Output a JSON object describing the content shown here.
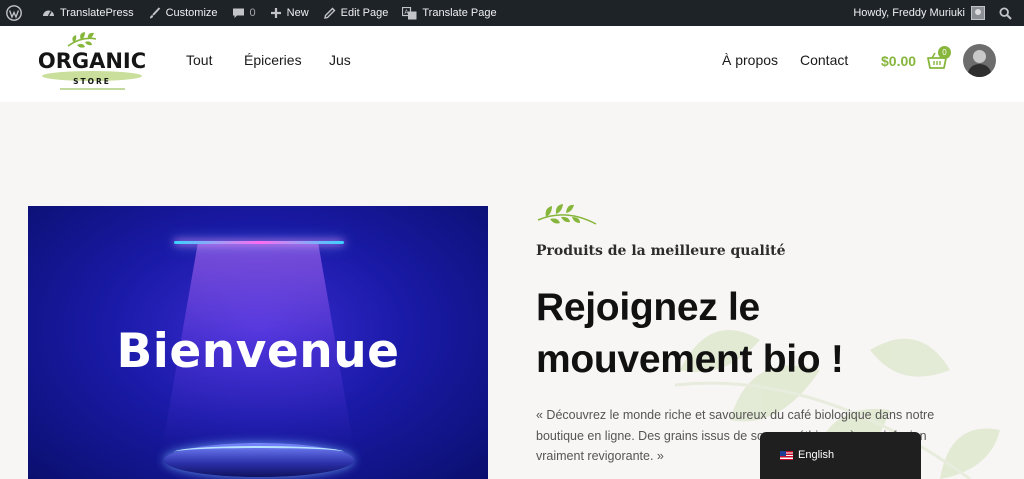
{
  "admin_bar": {
    "site_name": "TranslatePress",
    "customize": "Customize",
    "comments_count": "0",
    "new": "New",
    "edit_page": "Edit Page",
    "translate_page": "Translate Page",
    "greeting": "Howdy, Freddy Muriuki"
  },
  "logo": {
    "word": "ORGANIC",
    "sub": "STORE"
  },
  "nav": {
    "left": [
      "Tout",
      "Épiceries",
      "Jus"
    ],
    "right": [
      "À propos",
      "Contact"
    ]
  },
  "cart": {
    "total": "$0.00",
    "count": "0"
  },
  "hero": {
    "image_text": "Bienvenue",
    "tagline": "Produits de la meilleure qualité",
    "title": "Rejoignez le mouvement bio !",
    "description": "« Découvrez le monde riche et savoureux du café biologique dans notre boutique en ligne. Des grains issus de sources éthiques à une infusion vraiment revigorante. »"
  },
  "language_switcher": {
    "current": "English"
  },
  "colors": {
    "admin_bar": "#1d2327",
    "accent_green": "#86b63b",
    "annotation_red": "#e0001b"
  }
}
